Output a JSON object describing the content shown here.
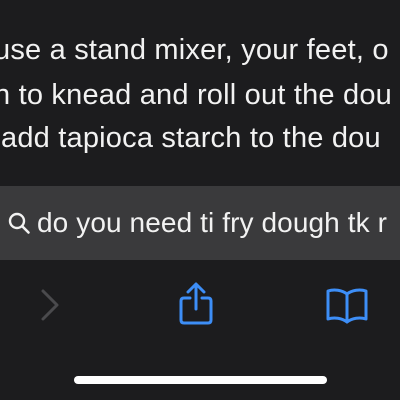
{
  "article": {
    "lines": [
      "use a stand mixer, your feet, o",
      "n to knead and roll out the dou",
      "add tapioca starch to the dou"
    ]
  },
  "find_bar": {
    "query": "do you need ti fry dough tk r"
  },
  "toolbar": {
    "forward_icon": "chevron-right-icon",
    "share_icon": "share-icon",
    "bookmarks_icon": "book-icon"
  },
  "colors": {
    "background": "#1c1c1e",
    "find_bar_bg": "#3a3a3c",
    "accent": "#3d8ef7",
    "disabled": "#4a4a4d",
    "text": "#f2f2f2"
  }
}
